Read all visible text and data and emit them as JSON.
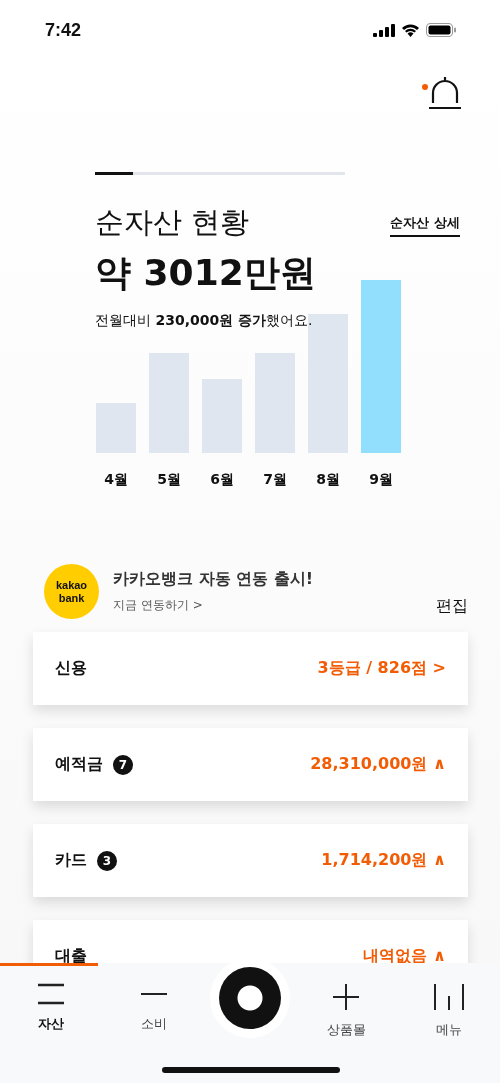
{
  "status_bar": {
    "time": "7:42"
  },
  "notification": {
    "unread": true
  },
  "summary": {
    "page_indicator": {
      "level": 0.15
    },
    "title": "순자산 현황",
    "detail_link": "순자산 상세",
    "amount": "약 3012만원",
    "change": "전월대비 **230,000원 증가**했어요."
  },
  "months": [
    {
      "label": "4월",
      "selected": false
    },
    {
      "label": "5월",
      "selected": false
    },
    {
      "label": "6월",
      "selected": false
    },
    {
      "label": "7월",
      "selected": false
    },
    {
      "label": "8월",
      "selected": false
    },
    {
      "label": "9월",
      "selected": true
    }
  ],
  "promo": {
    "logo_top": "kakao",
    "logo_bottom": "bank",
    "title": "카카오뱅크 자동 연동 출시!",
    "link": "지금 연동하기 >",
    "edit": "편집"
  },
  "cards": [
    {
      "label": "신용",
      "value": "3등급 / 826점 >"
    },
    {
      "label": "예적금",
      "badge": "7",
      "value": "28,310,000원 ∧"
    },
    {
      "label": "카드",
      "badge": "3",
      "value": "1,714,200원 ∧"
    },
    {
      "label": "대출",
      "value": "내역없음 ∧"
    }
  ],
  "nav": [
    {
      "kind": "lines",
      "label": "자산",
      "selected": true
    },
    {
      "kind": "minus",
      "label": "소비",
      "selected": false
    },
    {
      "kind": "center"
    },
    {
      "kind": "plus",
      "label": "상품몰",
      "selected": false
    },
    {
      "kind": "bars",
      "label": "메뉴",
      "selected": false
    }
  ]
}
